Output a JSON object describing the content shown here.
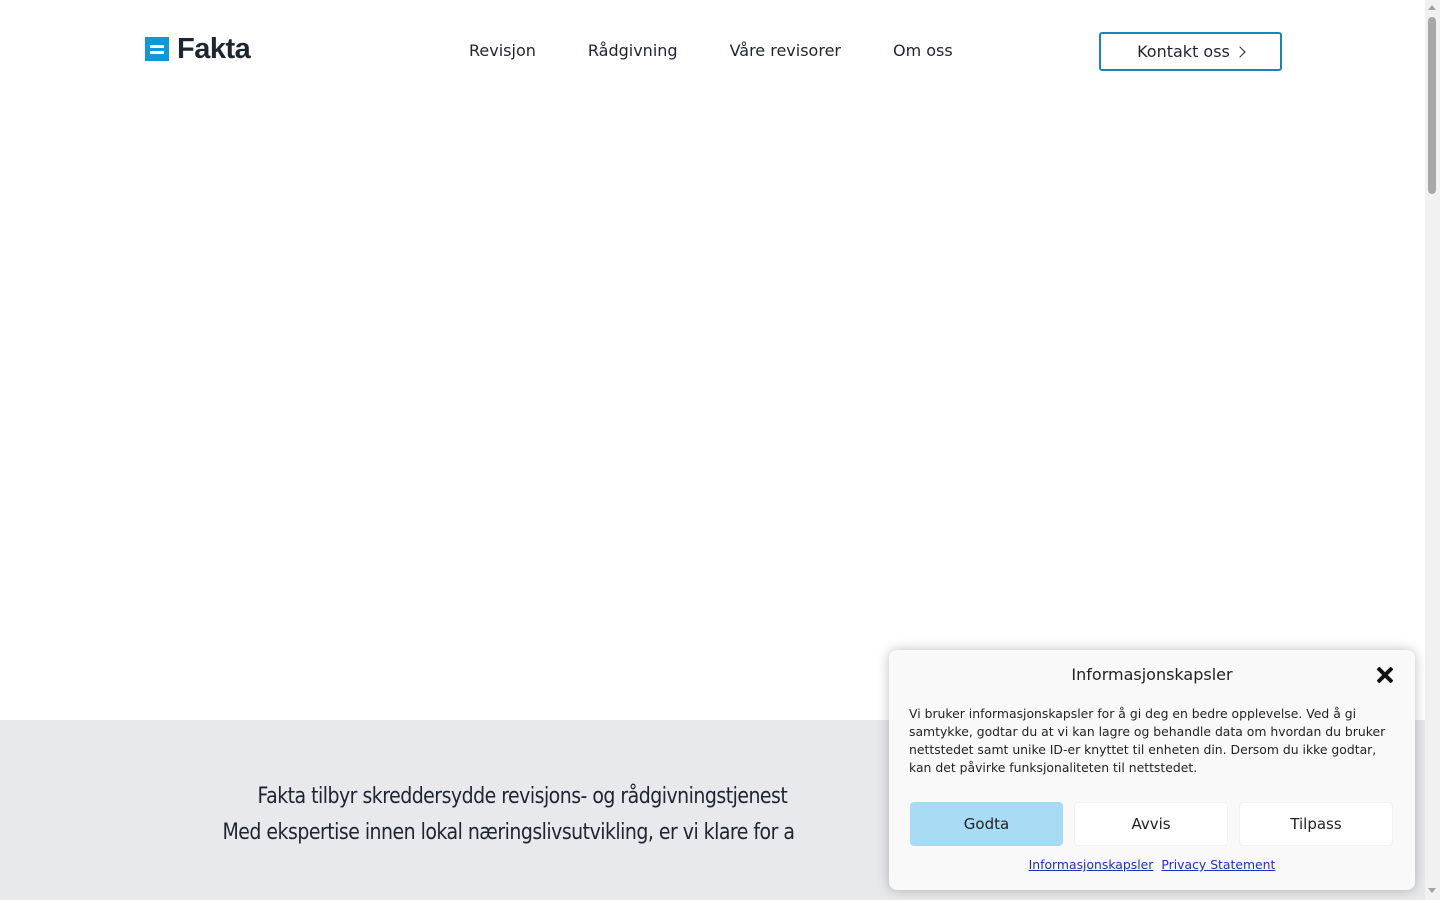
{
  "header": {
    "logo_text": "Fakta",
    "nav": [
      "Revisjon",
      "Rådgivning",
      "Våre revisorer",
      "Om oss"
    ],
    "contact_label": "Kontakt oss"
  },
  "intro": {
    "line1": "Fakta tilbyr skreddersydde revisjons- og rådgivningstjenest",
    "line2": "Med ekspertise innen lokal næringslivsutvikling, er vi klare for a"
  },
  "cookie_banner": {
    "title": "Informasjonskapsler",
    "text": "Vi bruker informasjonskapsler for å gi deg en bedre opplevelse. Ved å gi samtykke, godtar du at vi kan lagre og behandle data om hvordan du bruker nettstedet samt unike ID-er knyttet til enheten din. Dersom du ikke godtar, kan det påvirke funksjonaliteten til nettstedet.",
    "accept_label": "Godta",
    "reject_label": "Avvis",
    "customize_label": "Tilpass",
    "links": [
      "Informasjonskapsler",
      "Privacy Statement"
    ]
  },
  "colors": {
    "brand": "#1097d5",
    "accept_button": "#a8dcf4",
    "intro_background": "#e8e9ec",
    "link": "#1e2fc2"
  },
  "icons": {
    "logo": "logo-mark-icon",
    "contact_chevron": "chevron-right-icon",
    "close": "close-icon"
  }
}
